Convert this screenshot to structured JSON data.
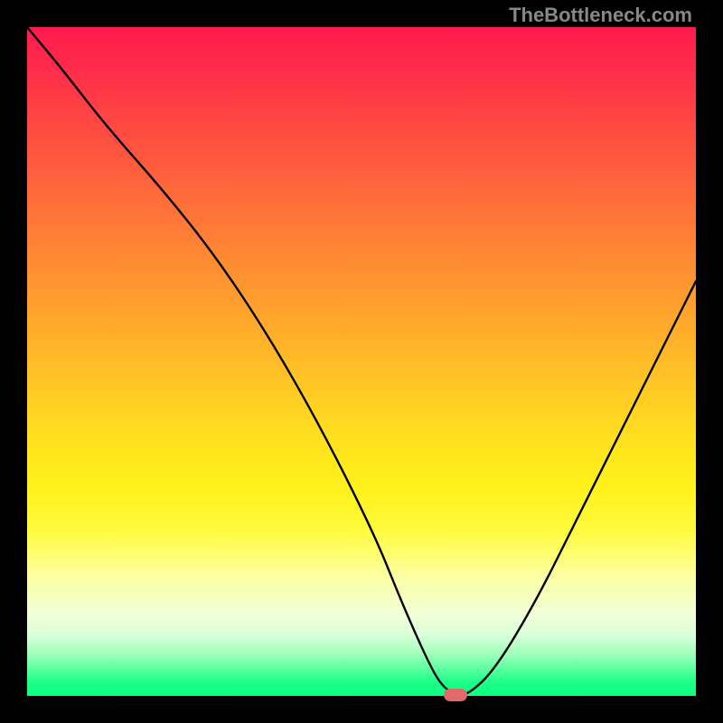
{
  "watermark": "TheBottleneck.com",
  "chart_data": {
    "type": "line",
    "title": "",
    "xlabel": "",
    "ylabel": "",
    "xlim": [
      0,
      100
    ],
    "ylim": [
      0,
      100
    ],
    "x": [
      0,
      5,
      12,
      20,
      28,
      36,
      44,
      52,
      56,
      60,
      62,
      64,
      66,
      70,
      76,
      82,
      88,
      94,
      100
    ],
    "values": [
      100,
      94,
      85,
      76,
      66,
      54,
      40,
      24,
      14,
      5,
      1.5,
      0.2,
      0.2,
      4,
      14,
      26,
      38,
      50,
      62
    ],
    "marker": {
      "x": 64,
      "y": 0.2
    },
    "gradient_stops": [
      {
        "pos": 0,
        "color": "#ff1a4d"
      },
      {
        "pos": 50,
        "color": "#ffc226"
      },
      {
        "pos": 75,
        "color": "#fffb3a"
      },
      {
        "pos": 100,
        "color": "#0aff80"
      }
    ]
  }
}
